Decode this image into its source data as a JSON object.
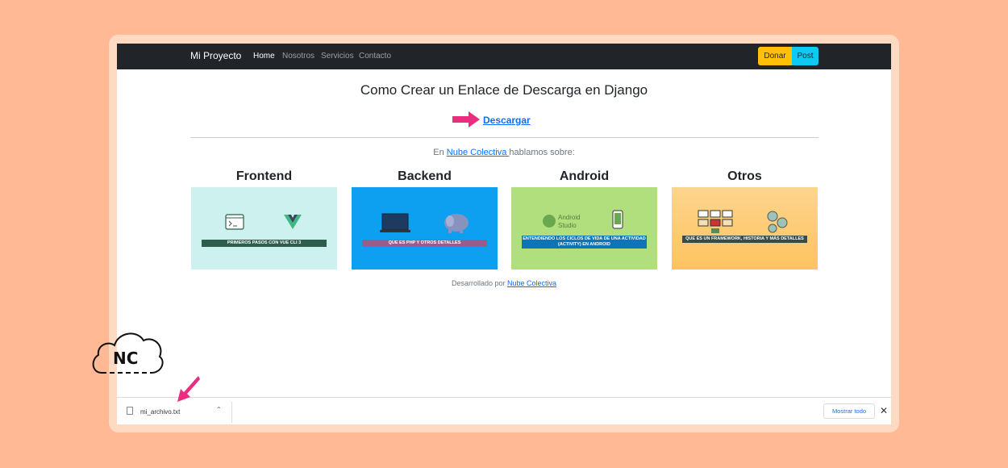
{
  "navbar": {
    "brand": "Mi Proyecto",
    "links": [
      "Home",
      "Nosotros",
      "Servicios",
      "Contacto"
    ],
    "donar_label": "Donar",
    "post_label": "Post"
  },
  "main": {
    "title": "Como Crear un Enlace de Descarga en Django",
    "download_label": "Descargar",
    "subtitle_prefix": "En ",
    "subtitle_link": "Nube Colectiva ",
    "subtitle_suffix": "hablamos sobre:"
  },
  "cards": [
    {
      "title": "Frontend",
      "banner": "PRIMEROS PASOS CON VUE CLI 3",
      "bg": "#cdf1ee",
      "banner_bg": "#2e5d4b"
    },
    {
      "title": "Backend",
      "banner": "QUE ES PHP Y OTROS DETALLES",
      "bg": "#0ea0f0",
      "banner_bg": "#9b5b8f"
    },
    {
      "title": "Android",
      "banner": "ENTENDIENDO LOS CICLOS DE VIDA DE UNA ACTIVIDAD (ACTIVITY) EN ANDROID",
      "bg": "#b2df7e",
      "banner_bg": "#0d74b8"
    },
    {
      "title": "Otros",
      "banner": "QUE ES UN FRAMEWORK, HISTORIA Y MÁS DETALLES",
      "bg": "#fdc87a",
      "banner_bg": "#3a4a45"
    }
  ],
  "footer": {
    "prefix": "Desarrollado por ",
    "link": "Nube Colectiva"
  },
  "download_bar": {
    "file_name": "mi_archivo.txt",
    "show_all": "Mostrar todo",
    "close": "✕"
  },
  "watermark": {
    "text": "NC"
  },
  "colors": {
    "background": "#ffb994",
    "navbar": "#212529",
    "accent_pink": "#ec2c7e",
    "link": "#0d6efd"
  }
}
